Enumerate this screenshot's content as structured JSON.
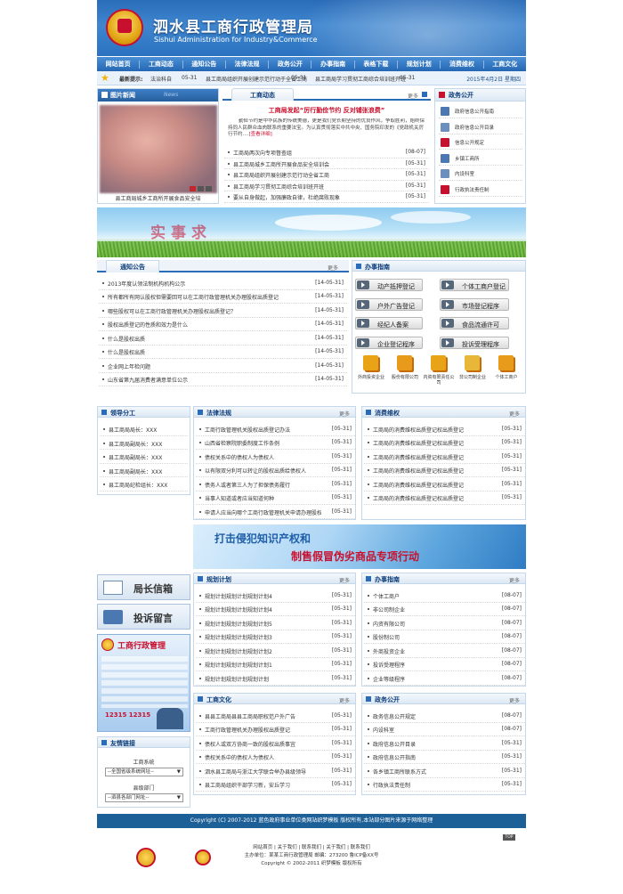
{
  "header": {
    "title": "泗水县工商行政管理局",
    "subtitle": "Sishui Administration for Industry&Commerce"
  },
  "nav": [
    "网站首页",
    "工商动态",
    "通知公告",
    "法律法规",
    "政务公开",
    "办事指南",
    "表格下载",
    "规划计划",
    "消费维权",
    "工商文化"
  ],
  "ticker": {
    "label": "最新提示:",
    "items": [
      {
        "t": "法治科自",
        "d": "05-31"
      },
      {
        "t": "县工商局组织开展创建示范行动于全省工商",
        "d": "05-31"
      },
      {
        "t": "县工商局学习贯彻工商综合培训班开班",
        "d": "05-31"
      }
    ],
    "date": "2015年4月2日 星期四"
  },
  "photo": {
    "title": "图片新闻",
    "tag": "News",
    "caption": "县工商局城乡工商所开展食品安全培"
  },
  "dynamic": {
    "title": "工商动态",
    "more": "更多",
    "headline": "工商局发起“厉行勤俭节约 反对铺张浪费”",
    "intro": "勤俭节约是中华民族的传统美德，更是我们党长期坚持的优良作风，争取胜利，始终保持同人民群众血肉联系的重要法宝。为认真贯彻落实中共中央、国务院印发的《党政机关厉行节约....",
    "link": "[查看详细]",
    "items": [
      {
        "t": "工商局两次向专项督查组",
        "d": "[08-07]"
      },
      {
        "t": "县工商局城乡工商所开展食品安全培训会",
        "d": "[05-31]"
      },
      {
        "t": "县工商局组织开展创建示范行动全省工商",
        "d": "[05-31]"
      },
      {
        "t": "县工商局学习贯彻工商综合培训班开班",
        "d": "[05-31]"
      },
      {
        "t": "要从自身做起，加强廉政自律，杜绝腐败现象",
        "d": "[05-31]"
      }
    ]
  },
  "affairs": {
    "title": "政务公开",
    "items": [
      "政府信息公开指南",
      "政府信息公开目录",
      "信息公开规定",
      "乡镇工商所",
      "内设科室",
      "行政执法责任制"
    ]
  },
  "banner_text": "实事求",
  "notice": {
    "title": "通知公告",
    "more": "更多",
    "items": [
      {
        "t": "2013年度认领法制机构机构公示",
        "d": "[14-05-31]"
      },
      {
        "t": "所有都所有网认股权但需要回可以在工商行政管理机关办理股权出质登记",
        "d": "[14-05-31]"
      },
      {
        "t": "哪些股权可以在工商行政管理机关办理股权出质登记？",
        "d": "[14-05-31]"
      },
      {
        "t": "股权出质登记的性质和效力是什么",
        "d": "[14-05-31]"
      },
      {
        "t": "什么是股权出质",
        "d": "[14-05-31]"
      },
      {
        "t": "什么是股权出质",
        "d": "[14-05-31]"
      },
      {
        "t": "企业网上年检问题",
        "d": "[14-05-31]"
      },
      {
        "t": "山东省第九届消费者满意单位公示",
        "d": "[14-05-31]"
      }
    ]
  },
  "guide": {
    "title": "办事指南",
    "buttons": [
      "动产抵押登记",
      "个体工商户登记",
      "户外广告登记",
      "市场登记程序",
      "经纪人备案",
      "食品流通许可",
      "企业登记程序",
      "投诉受理程序"
    ],
    "icons": [
      "外商投资企业",
      "股份有限公司",
      "内资有限责任公司",
      "非公司制企业",
      "个体工商户"
    ]
  },
  "leaders": {
    "title": "领导分工",
    "items": [
      "县工商局局长：XXX",
      "县工商局副局长：XXX",
      "县工商局副局长：XXX",
      "县工商局副局长：XXX",
      "县工商局纪检组长：XXX"
    ]
  },
  "law": {
    "title": "法律法规",
    "more": "更多",
    "items": [
      {
        "t": "工商行政管理机关股权出质登记办法",
        "d": "[05-31]"
      },
      {
        "t": "山西省检察院职委制度工作条例",
        "d": "[05-31]"
      },
      {
        "t": "债权关系中的债权人为债权人",
        "d": "[05-31]"
      },
      {
        "t": "以有限双分利可以转让的股权出质给债权人",
        "d": "[05-31]"
      },
      {
        "t": "债务人或者第三人为了担保债务履行",
        "d": "[05-31]"
      },
      {
        "t": "当事人知道或者应当知道何种",
        "d": "[05-31]"
      },
      {
        "t": "申请人应当向哪个工商行政管理机关申请办理股权",
        "d": "[05-31]"
      }
    ]
  },
  "consumer": {
    "title": "消费维权",
    "more": "更多",
    "items": [
      {
        "t": "工商局的消费维权出质登记权出质登记",
        "d": "[05-31]"
      },
      {
        "t": "工商局的消费维权出质登记权出质登记",
        "d": "[05-31]"
      },
      {
        "t": "工商局的消费维权出质登记权出质登记",
        "d": "[05-31]"
      },
      {
        "t": "工商局的消费维权出质登记权出质登记",
        "d": "[05-31]"
      },
      {
        "t": "工商局的消费维权出质登记权出质登记",
        "d": "[05-31]"
      },
      {
        "t": "工商局的消费维权出质登记权出质登记",
        "d": "[05-31]"
      }
    ]
  },
  "ip_banner": {
    "line1": "打击侵犯知识产权和",
    "line2": "制售假冒伪劣商品专项行动"
  },
  "mail_btn": "局长信箱",
  "msg_btn": "投诉留言",
  "promo": {
    "title": "工商行政管理",
    "phone": "12315 12315"
  },
  "plan": {
    "title": "规划计划",
    "more": "更多",
    "items": [
      {
        "t": "规划计划规划计划规划计划4",
        "d": "[05-31]"
      },
      {
        "t": "规划计划规划计划规划计划4",
        "d": "[05-31]"
      },
      {
        "t": "规划计划规划计划规划计划5",
        "d": "[05-31]"
      },
      {
        "t": "规划计划规划计划规划计划3",
        "d": "[05-31]"
      },
      {
        "t": "规划计划规划计划规划计划2",
        "d": "[05-31]"
      },
      {
        "t": "规划计划规划计划规划计划1",
        "d": "[05-31]"
      },
      {
        "t": "规划计划规划计划规划计划",
        "d": "[05-31]"
      }
    ]
  },
  "guide2": {
    "title": "办事指南",
    "more": "更多",
    "items": [
      {
        "t": "个体工商户",
        "d": "[08-07]"
      },
      {
        "t": "非公司制企业",
        "d": "[08-07]"
      },
      {
        "t": "内资有限公司",
        "d": "[08-07]"
      },
      {
        "t": "股份制公司",
        "d": "[08-07]"
      },
      {
        "t": "外商投资企业",
        "d": "[08-07]"
      },
      {
        "t": "投诉受理程序",
        "d": "[08-07]"
      },
      {
        "t": "企业等级程序",
        "d": "[08-07]"
      }
    ]
  },
  "culture": {
    "title": "工商文化",
    "more": "更多",
    "items": [
      {
        "t": "县县工商局县县工商局职权范户外广告",
        "d": "[05-31]"
      },
      {
        "t": "工商行政管理机关办理股权出质登记",
        "d": "[05-31]"
      },
      {
        "t": "债权人或双方协商一致的股权出质事宜",
        "d": "[05-31]"
      },
      {
        "t": "债权关系中的债权人为债权人",
        "d": "[05-31]"
      },
      {
        "t": "泗水县工商局与浙江大学联合举办县级领导",
        "d": "[05-31]"
      },
      {
        "t": "县工商局组织干部学习新，安丘学习",
        "d": "[05-31]"
      }
    ]
  },
  "affairs2": {
    "title": "政务公开",
    "more": "更多",
    "items": [
      {
        "t": "政务信息公开规定",
        "d": "[08-07]"
      },
      {
        "t": "内设科室",
        "d": "[08-07]"
      },
      {
        "t": "政府信息公开目录",
        "d": "[05-31]"
      },
      {
        "t": "政府信息公开指南",
        "d": "[05-31]"
      },
      {
        "t": "各乡镇工商所联系方式",
        "d": "[05-31]"
      },
      {
        "t": "行政执法责任制",
        "d": "[05-31]"
      }
    ]
  },
  "links": {
    "title": "友情链接",
    "l1": "工商系统",
    "s1": "--全国省级系统网址--",
    "l2": "县级部门",
    "s2": "--泗县各部门网址--"
  },
  "footer": {
    "bar": "Copyright (C) 2007-2012 蓝色政府事业单位类网站织梦模板 版权所有,本站部分图片来源于网络整理",
    "top": "TOP",
    "links": "网站首页 | 关于我们 | 联系我们 | 关于我们 | 联系我们",
    "addr": "主办单位：某某工商行政管理局 邮编：273200 鲁ICP备XX号",
    "copy": "Copyright © 2002-2011 织梦模板 版权所有"
  }
}
